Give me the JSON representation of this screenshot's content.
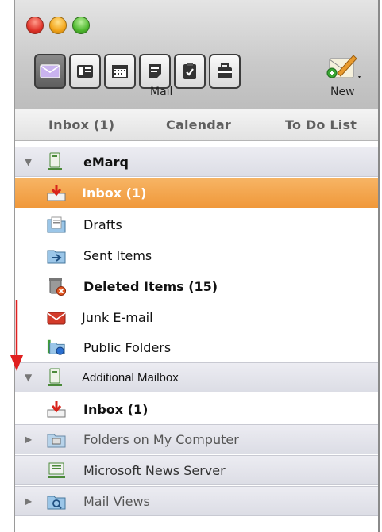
{
  "toolbar": {
    "window_controls": [
      "close",
      "minimize",
      "zoom"
    ],
    "views": [
      {
        "icon": "mail-icon",
        "active": true
      },
      {
        "icon": "contacts-icon",
        "active": false
      },
      {
        "icon": "calendar-icon",
        "active": false
      },
      {
        "icon": "notes-icon",
        "active": false
      },
      {
        "icon": "tasks-icon",
        "active": false
      },
      {
        "icon": "project-icon",
        "active": false
      }
    ],
    "view_label": "Mail",
    "new_label": "New"
  },
  "tabs": [
    "Inbox (1)",
    "Calendar",
    "To Do List"
  ],
  "folders": {
    "account1": {
      "name": "eMarq",
      "expanded": true
    },
    "inbox": "Inbox (1)",
    "drafts": "Drafts",
    "sent": "Sent Items",
    "deleted": "Deleted Items (15)",
    "junk": "Junk E-mail",
    "public": "Public Folders",
    "additional": "Additional Mailbox",
    "additional_inbox": "Inbox (1)",
    "on_my_computer": "Folders on My Computer",
    "news_server": "Microsoft News Server",
    "mail_views": "Mail Views"
  },
  "colors": {
    "selection": "#f0983a",
    "annotation_arrow": "#e02020"
  }
}
